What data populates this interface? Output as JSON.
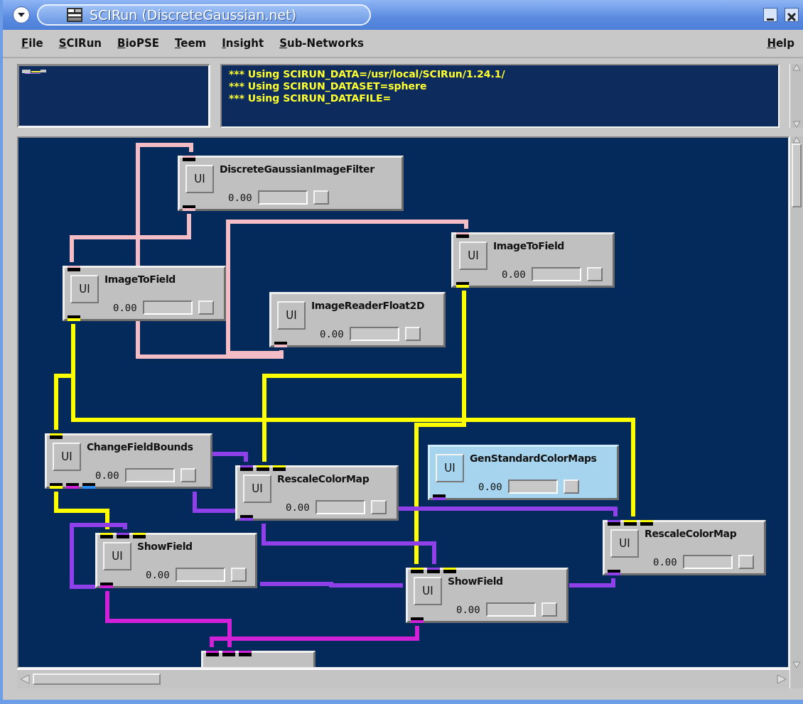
{
  "window": {
    "title": "SCIRun (DiscreteGaussian.net)"
  },
  "menu": [
    {
      "label": "File"
    },
    {
      "label": "SCIRun"
    },
    {
      "label": "BioPSE"
    },
    {
      "label": "Teem"
    },
    {
      "label": "Insight"
    },
    {
      "label": "Sub-Networks"
    },
    {
      "label": "Help"
    }
  ],
  "log": [
    "*** Using SCIRUN_DATA=/usr/local/SCIRun/1.24.1/",
    "*** Using SCIRUN_DATASET=sphere",
    "*** Using SCIRUN_DATAFILE="
  ],
  "wires": [
    {
      "color": "#f4bcc4"
    },
    {
      "color": "#f4bcc4"
    },
    {
      "color": "#f4bcc4"
    },
    {
      "color": "#ffff00"
    },
    {
      "color": "#ffff00"
    },
    {
      "color": "#ffff00"
    },
    {
      "color": "#ffff00"
    },
    {
      "color": "#ffff00"
    },
    {
      "color": "#9040e8"
    },
    {
      "color": "#9040e8"
    },
    {
      "color": "#9040e8"
    },
    {
      "color": "#9040e8"
    },
    {
      "color": "#9040e8"
    },
    {
      "color": "#9040e8"
    },
    {
      "color": "#9040e8"
    },
    {
      "color": "#d020d8"
    },
    {
      "color": "#d020d8"
    }
  ],
  "modules": [
    {
      "kind": "module",
      "title": "DiscreteGaussianImageFilter",
      "button": "UI",
      "value": "0.00",
      "level": 0,
      "selected": false,
      "inputs": [
        {
          "color": "#f4bcc4"
        }
      ],
      "outputs": [
        {
          "color": "#f4bcc4"
        }
      ]
    },
    {
      "kind": "module",
      "title": "ImageToField",
      "button": "UI",
      "value": "0.00",
      "level": 0,
      "selected": false,
      "inputs": [
        {
          "color": "#f4bcc4"
        }
      ],
      "outputs": [
        {
          "color": "#ffff00"
        }
      ]
    },
    {
      "kind": "module",
      "title": "ImageToField",
      "button": "UI",
      "value": "0.00",
      "level": 0,
      "selected": false,
      "inputs": [
        {
          "color": "#f4bcc4"
        }
      ],
      "outputs": [
        {
          "color": "#ffff00"
        }
      ]
    },
    {
      "kind": "module",
      "title": "ImageReaderFloat2D",
      "button": "UI",
      "value": "0.00",
      "level": 0,
      "selected": false,
      "outputs": [
        {
          "color": "#f4bcc4"
        }
      ]
    },
    {
      "kind": "module",
      "title": "ChangeFieldBounds",
      "button": "UI",
      "value": "0.00",
      "level": 0,
      "selected": false,
      "inputs": [
        {
          "color": "#ffff00"
        }
      ],
      "outputs": [
        {
          "color": "#ffff00"
        },
        {
          "color": "#d020d8"
        },
        {
          "color": "#2a8cf0"
        }
      ]
    },
    {
      "kind": "module",
      "title": "RescaleColorMap",
      "button": "UI",
      "value": "0.00",
      "level": 0,
      "selected": false,
      "inputs": [
        {
          "color": "#9040e8"
        },
        {
          "color": "#ffff00"
        },
        {
          "color": "#ffff00"
        }
      ],
      "outputs": [
        {
          "color": "#9040e8"
        }
      ]
    },
    {
      "kind": "module",
      "title": "GenStandardColorMaps",
      "button": "UI",
      "value": "0.00",
      "level": 0,
      "selected": true,
      "outputs": [
        {
          "color": "#9040e8"
        }
      ]
    },
    {
      "kind": "module",
      "title": "RescaleColorMap",
      "button": "UI",
      "value": "0.00",
      "level": 0,
      "selected": false,
      "inputs": [
        {
          "color": "#9040e8"
        },
        {
          "color": "#ffff00"
        },
        {
          "color": "#ffff00"
        }
      ],
      "outputs": [
        {
          "color": "#9040e8"
        }
      ]
    },
    {
      "kind": "module",
      "title": "ShowField",
      "button": "UI",
      "value": "0.00",
      "level": 0,
      "selected": false,
      "inputs": [
        {
          "color": "#ffff00"
        },
        {
          "color": "#9040e8"
        },
        {
          "color": "#ffff00"
        }
      ],
      "outputs": [
        {
          "color": "#d020d8"
        }
      ]
    },
    {
      "kind": "module",
      "title": "ShowField",
      "button": "UI",
      "value": "0.00",
      "level": 0,
      "selected": false,
      "inputs": [
        {
          "color": "#ffff00"
        },
        {
          "color": "#9040e8"
        },
        {
          "color": "#ffff00"
        }
      ],
      "outputs": [
        {
          "color": "#d020d8"
        }
      ]
    },
    {
      "kind": "clipped",
      "selected": false,
      "inputs": [
        {
          "color": "#d020d8"
        },
        {
          "color": "#d020d8"
        },
        {
          "color": "#d020d8"
        }
      ]
    }
  ]
}
